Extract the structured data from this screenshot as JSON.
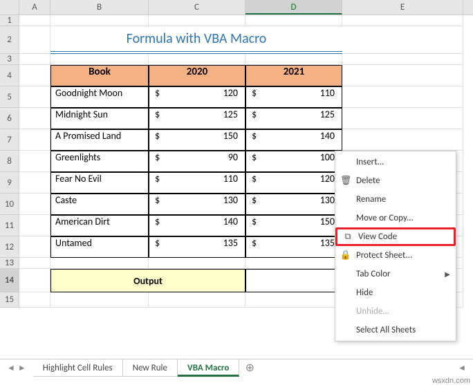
{
  "columns": [
    "A",
    "B",
    "C",
    "D",
    "E"
  ],
  "title": "Formula with VBA Macro",
  "headers": {
    "book": "Book",
    "y1": "2020",
    "y2": "2021"
  },
  "rows": [
    {
      "book": "Goodnight Moon",
      "y1": "120",
      "y2": "110"
    },
    {
      "book": "Midnight Sun",
      "y1": "125",
      "y2": "125"
    },
    {
      "book": "A Promised Land",
      "y1": "150",
      "y2": "140"
    },
    {
      "book": "Greenlights",
      "y1": "90",
      "y2": "100"
    },
    {
      "book": "Fear No Evil",
      "y1": "110",
      "y2": "120"
    },
    {
      "book": "Caste",
      "y1": "130",
      "y2": "130"
    },
    {
      "book": "American Dirt",
      "y1": "140",
      "y2": "150"
    },
    {
      "book": "Untamed",
      "y1": "135",
      "y2": "135"
    }
  ],
  "currency": "$",
  "output_label": "Output",
  "tabs": {
    "t1": "Highlight Cell Rules",
    "t2": "New Rule",
    "t3": "VBA Macro"
  },
  "menu": {
    "insert": "Insert...",
    "delete": "Delete",
    "rename": "Rename",
    "move_copy": "Move or Copy...",
    "view_code": "View Code",
    "protect": "Protect Sheet...",
    "tab_color": "Tab Color",
    "hide": "Hide",
    "unhide": "Unhide...",
    "select_all": "Select All Sheets"
  },
  "row_nums": [
    "1",
    "2",
    "3",
    "4",
    "5",
    "6",
    "7",
    "8",
    "9",
    "10",
    "11",
    "12",
    "13",
    "14",
    "15"
  ],
  "watermark": "wsxdn.com"
}
